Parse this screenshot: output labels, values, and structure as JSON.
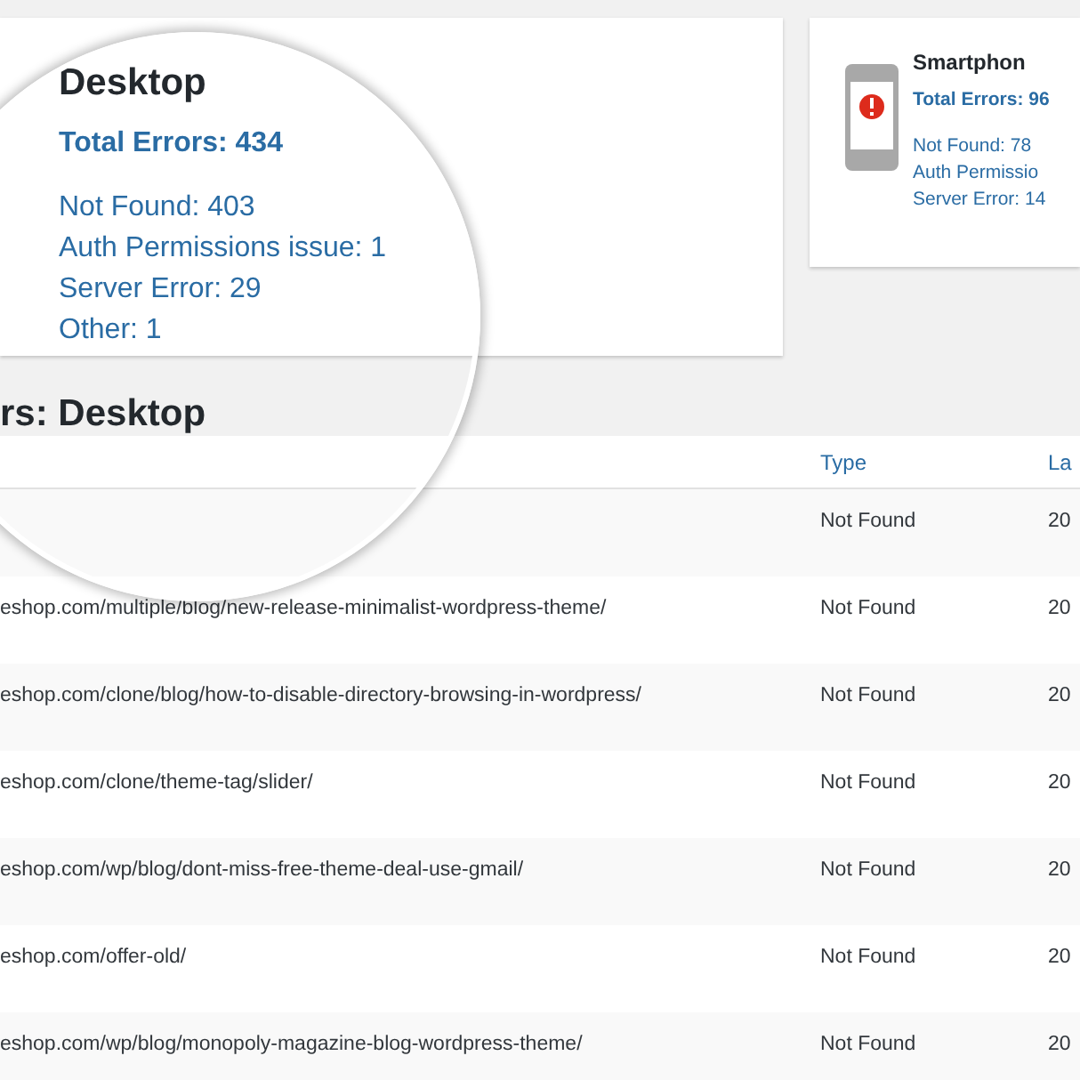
{
  "desktop_card": {
    "title": "Desktop",
    "total": "Total Errors: 434",
    "stats": [
      "Not Found: 403",
      "Auth Permissions issue: 1",
      "Server Error: 29",
      "Other: 1"
    ]
  },
  "smartphone_card": {
    "title": "Smartphon",
    "total": "Total Errors: 96",
    "stats": [
      "Not Found: 78",
      "Auth Permissio",
      "Server Error: 14"
    ]
  },
  "section_heading": "rs: Desktop",
  "table": {
    "columns": [
      "Type",
      "La"
    ],
    "rows": [
      {
        "type": "Not Found",
        "date": "20"
      },
      {
        "url": "eshop.com/multiple/blog/new-release-minimalist-wordpress-theme/",
        "type": "Not Found",
        "date": "20"
      },
      {
        "url": "eshop.com/clone/blog/how-to-disable-directory-browsing-in-wordpress/",
        "type": "Not Found",
        "date": "20"
      },
      {
        "url": "eshop.com/clone/theme-tag/slider/",
        "type": "Not Found",
        "date": "20"
      },
      {
        "url": "eshop.com/wp/blog/dont-miss-free-theme-deal-use-gmail/",
        "type": "Not Found",
        "date": "20"
      },
      {
        "url": "eshop.com/offer-old/",
        "type": "Not Found",
        "date": "20"
      },
      {
        "url": "eshop.com/wp/blog/monopoly-magazine-blog-wordpress-theme/",
        "type": "Not Found",
        "date": "20"
      }
    ]
  }
}
